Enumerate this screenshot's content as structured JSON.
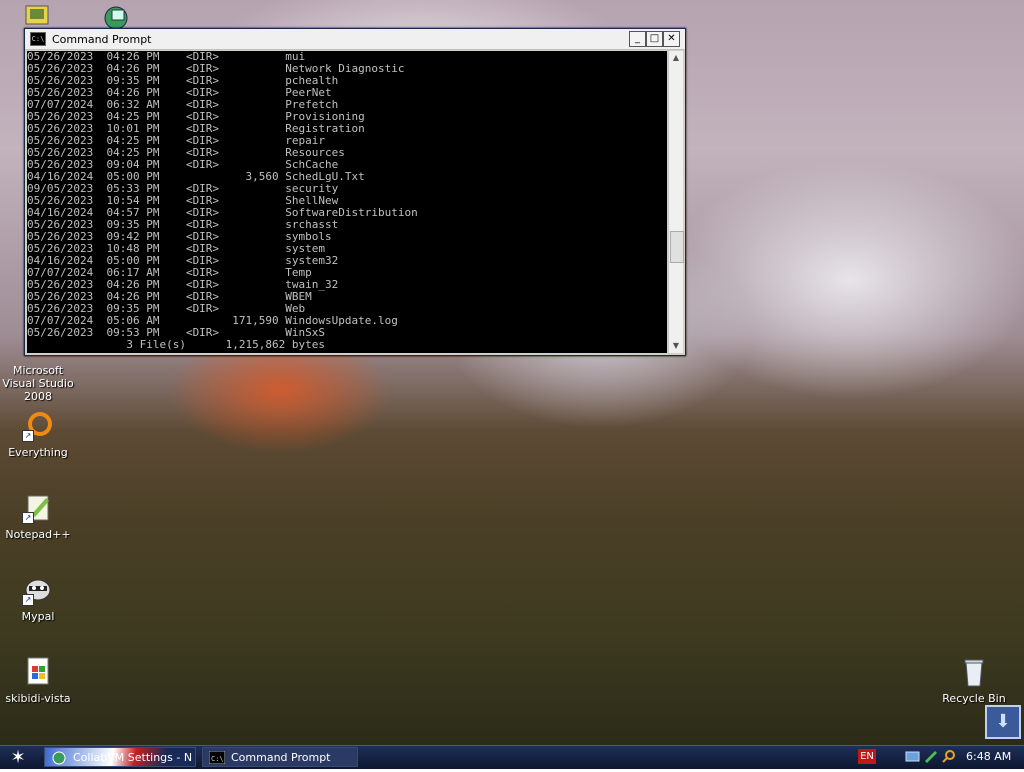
{
  "desktop": {
    "icons": [
      {
        "label": "Microsoft Visual Studio 2008"
      },
      {
        "label": "Everything"
      },
      {
        "label": "Notepad++"
      },
      {
        "label": "Mypal"
      },
      {
        "label": "skibidi-vista"
      },
      {
        "label": "Recycle Bin"
      }
    ]
  },
  "window": {
    "title": "Command Prompt",
    "controls": {
      "minimize": "_",
      "maximize": "□",
      "close": "✕"
    },
    "console_lines": [
      "05/26/2023  04:26 PM    <DIR>          mui",
      "05/26/2023  04:26 PM    <DIR>          Network Diagnostic",
      "05/26/2023  09:35 PM    <DIR>          pchealth",
      "05/26/2023  04:26 PM    <DIR>          PeerNet",
      "07/07/2024  06:32 AM    <DIR>          Prefetch",
      "05/26/2023  04:25 PM    <DIR>          Provisioning",
      "05/26/2023  10:01 PM    <DIR>          Registration",
      "05/26/2023  04:25 PM    <DIR>          repair",
      "05/26/2023  04:25 PM    <DIR>          Resources",
      "05/26/2023  09:04 PM    <DIR>          SchCache",
      "04/16/2024  05:00 PM             3,560 SchedLgU.Txt",
      "09/05/2023  05:33 PM    <DIR>          security",
      "05/26/2023  10:54 PM    <DIR>          ShellNew",
      "04/16/2024  04:57 PM    <DIR>          SoftwareDistribution",
      "05/26/2023  09:35 PM    <DIR>          srchasst",
      "05/26/2023  09:42 PM    <DIR>          symbols",
      "05/26/2023  10:48 PM    <DIR>          system",
      "04/16/2024  05:00 PM    <DIR>          system32",
      "07/07/2024  06:17 AM    <DIR>          Temp",
      "05/26/2023  04:26 PM    <DIR>          twain_32",
      "05/26/2023  04:26 PM    <DIR>          WBEM",
      "05/26/2023  09:35 PM    <DIR>          Web",
      "07/07/2024  05:06 AM           171,590 WindowsUpdate.log",
      "05/26/2023  09:53 PM    <DIR>          WinSxS",
      "               3 File(s)      1,215,862 bytes"
    ]
  },
  "taskbar": {
    "tasks": [
      {
        "label": "CollabVM Settings - N"
      },
      {
        "label": "Command Prompt"
      }
    ],
    "language": "EN",
    "clock": "6:48 AM"
  }
}
